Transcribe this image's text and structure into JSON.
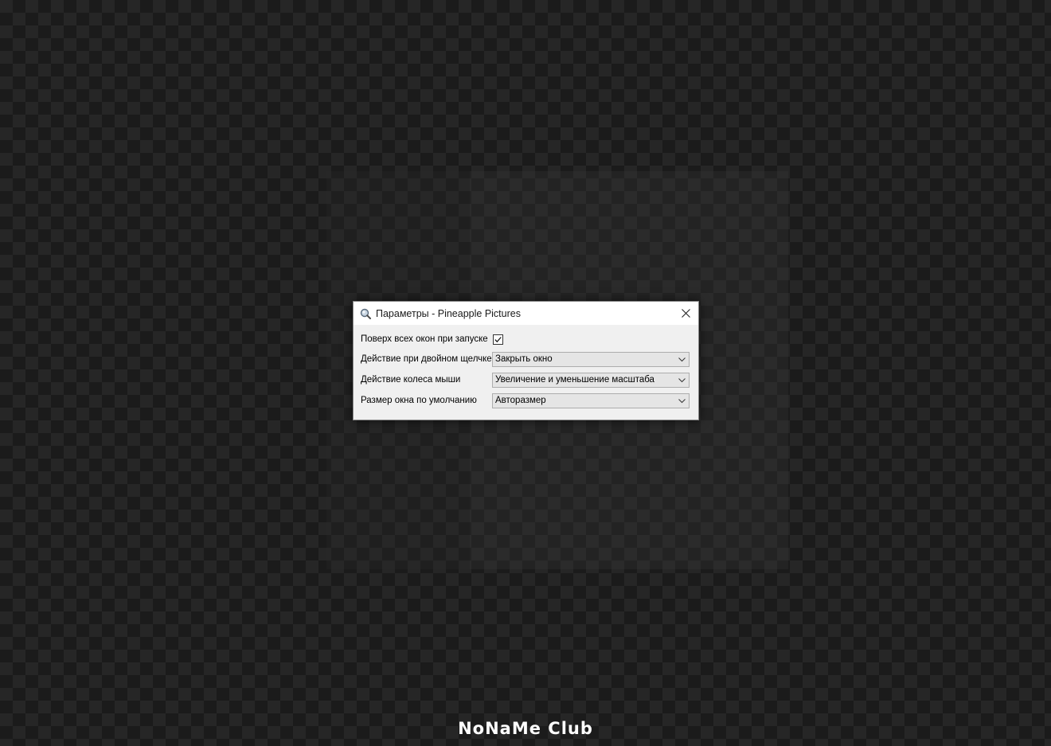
{
  "dialog": {
    "title": "Параметры - Pineapple Pictures",
    "rows": [
      {
        "label": "Поверх всех окон при запуске",
        "type": "checkbox",
        "checked": true
      },
      {
        "label": "Действие при двойном щелчке",
        "type": "combo",
        "value": "Закрыть окно"
      },
      {
        "label": "Действие колеса мыши",
        "type": "combo",
        "value": "Увеличение и уменьшение масштаба"
      },
      {
        "label": "Размер окна по умолчанию",
        "type": "combo",
        "value": "Авторазмер"
      }
    ]
  },
  "watermark": "NoNaMe Club",
  "icons": {
    "app": "magnifier-app-icon",
    "close": "close-icon",
    "checkbox": "checkmark-icon",
    "dropdown": "chevron-down-icon"
  },
  "colors": {
    "dialog_bg": "#f0f0f0",
    "titlebar_bg": "#ffffff",
    "combo_bg": "#e5e5e5",
    "combo_border": "#adadad"
  }
}
